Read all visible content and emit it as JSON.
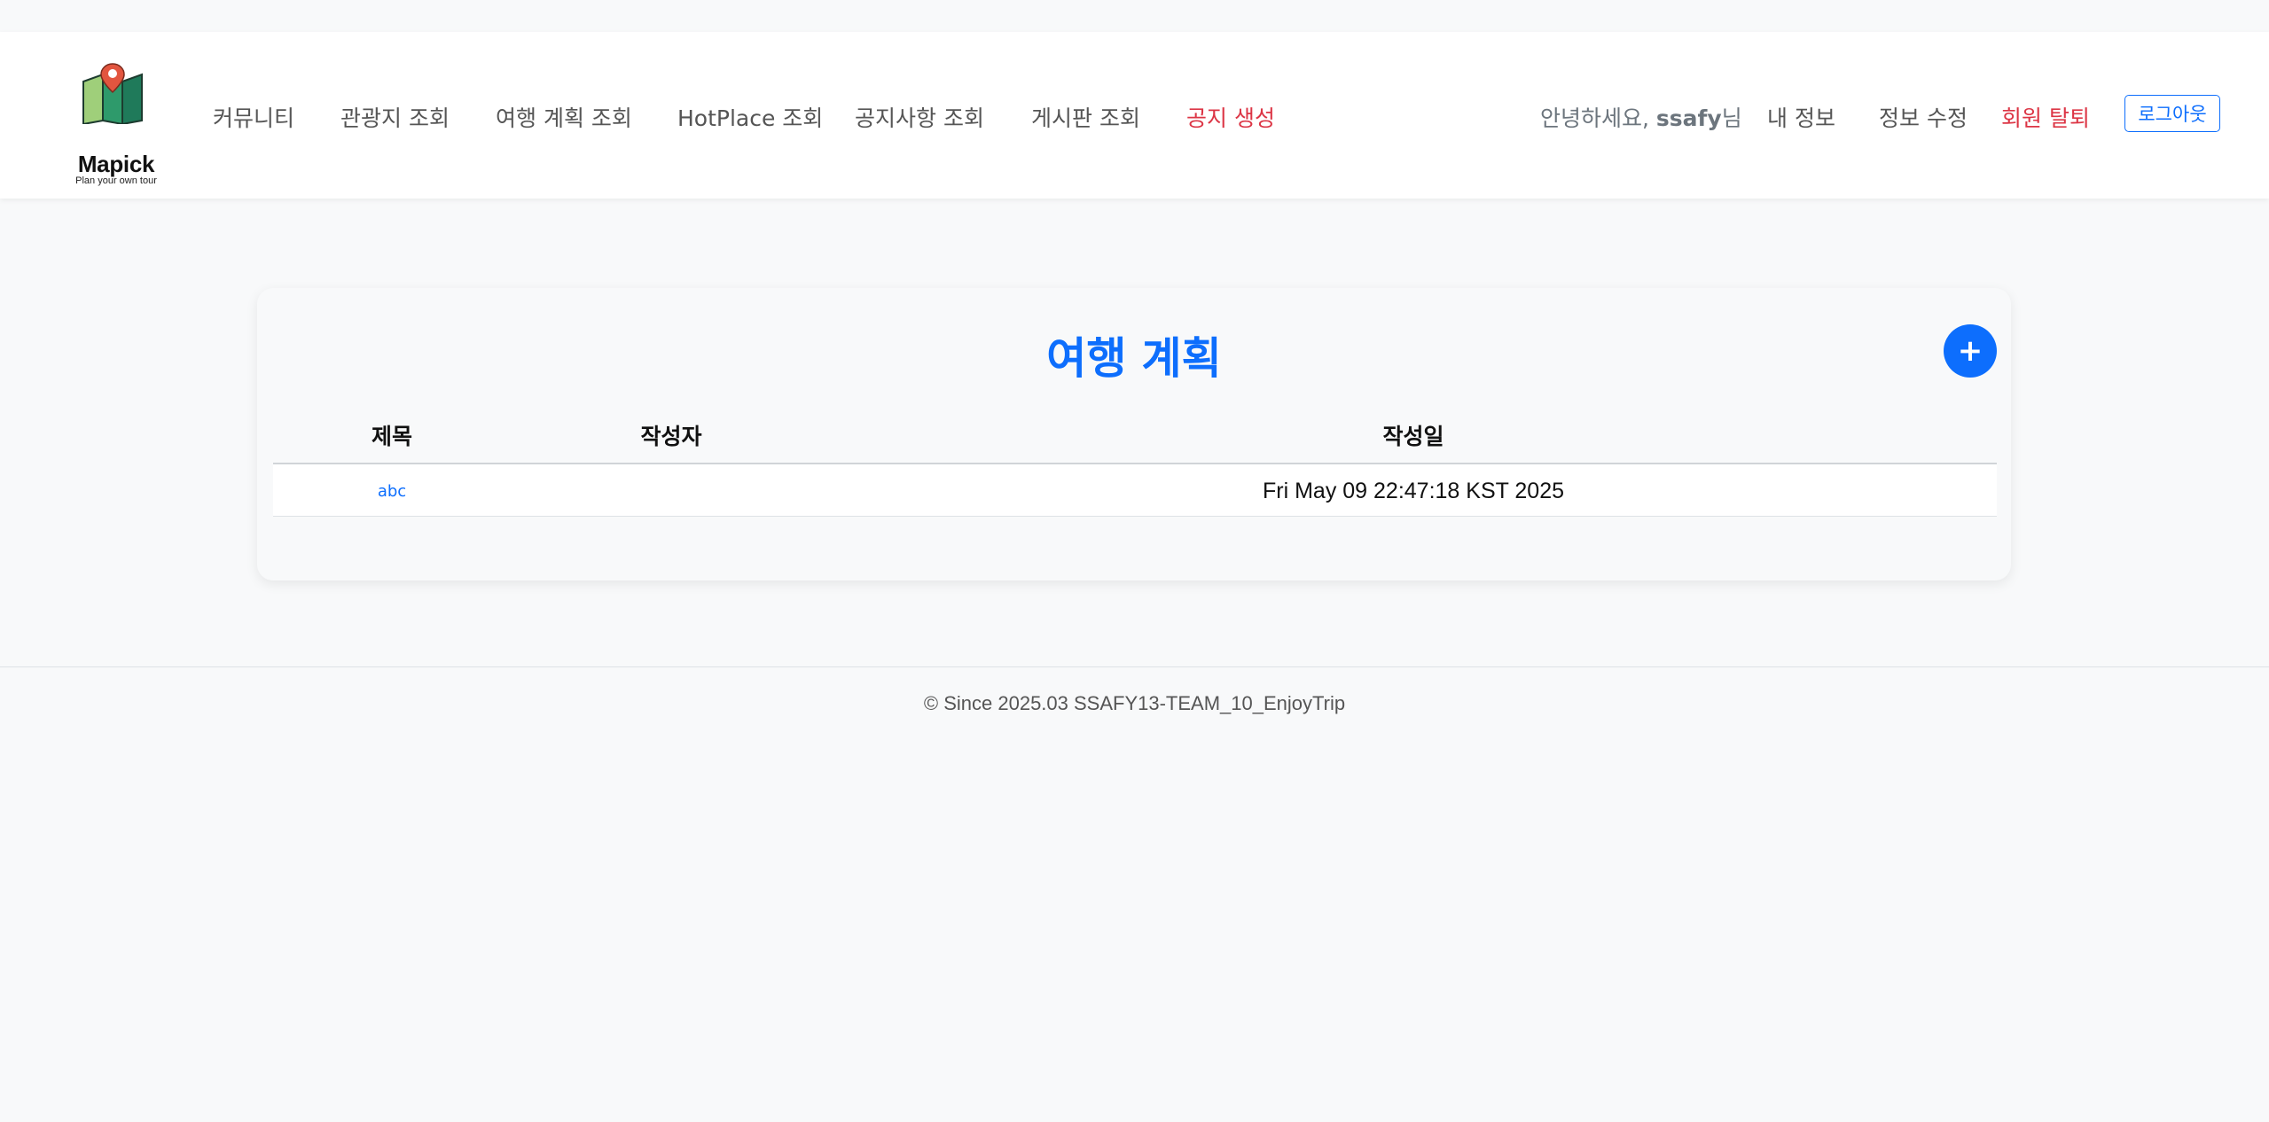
{
  "brand": {
    "name": "Mapick",
    "tagline": "Plan your own tour"
  },
  "nav": {
    "items": [
      {
        "label": "커뮤니티"
      },
      {
        "label": "관광지 조회"
      },
      {
        "label": "여행 계획 조회"
      },
      {
        "label": "HotPlace 조회"
      },
      {
        "label": "공지사항 조회"
      },
      {
        "label": "게시판 조회"
      },
      {
        "label": "공지 생성"
      }
    ]
  },
  "user": {
    "greeting_prefix": "안녕하세요, ",
    "username": "ssafy",
    "greeting_suffix": "님",
    "my_info": "내 정보",
    "edit_info": "정보 수정",
    "withdraw": "회원 탈퇴",
    "logout": "로그아웃"
  },
  "main": {
    "title": "여행 계획",
    "add_button": "+",
    "columns": [
      "제목",
      "작성자",
      "작성일"
    ],
    "rows": [
      {
        "title": "abc",
        "author": "",
        "date": "Fri May 09 22:47:18 KST 2025"
      }
    ]
  },
  "footer": {
    "text": "© Since 2025.03 SSAFY13-TEAM_10_EnjoyTrip"
  },
  "colors": {
    "accent": "#0d6efd",
    "danger": "#dc3545",
    "background": "#f8f9fa"
  }
}
